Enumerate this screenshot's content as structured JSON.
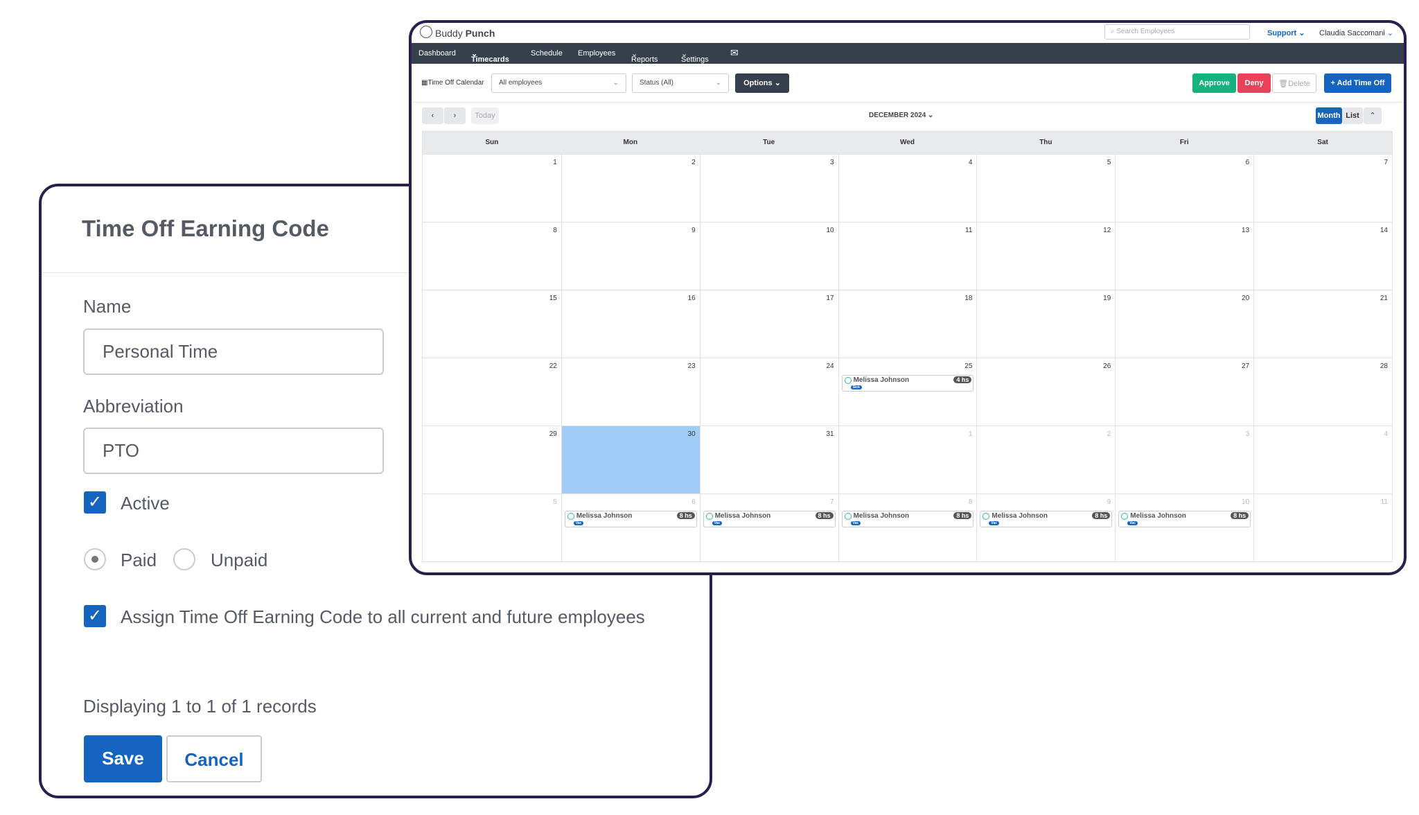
{
  "form": {
    "title": "Time Off Earning Code",
    "name_label": "Name",
    "name_value": "Personal Time",
    "abbr_label": "Abbreviation",
    "abbr_value": "PTO",
    "active_label": "Active",
    "active": true,
    "paid_label": "Paid",
    "unpaid_label": "Unpaid",
    "pay_type": "Paid",
    "assign_label": "Assign Time Off Earning Code to all current and future employees",
    "assign": true,
    "records": "Displaying 1 to 1 of 1 records",
    "save": "Save",
    "cancel": "Cancel"
  },
  "app": {
    "brand_light": "Buddy",
    "brand_bold": "Punch",
    "search_placeholder": "Search Employees",
    "support": "Support",
    "user": "Claudia Saccomani",
    "nav": [
      "Dashboard",
      "Timecards",
      "Schedule",
      "Employees",
      "Reports",
      "Settings"
    ],
    "toolbar": {
      "page": "Time Off Calendar",
      "employees": "All employees",
      "status": "Status (All)",
      "options": "Options",
      "approve": "Approve",
      "deny": "Deny",
      "delete": "Delete",
      "add": "+ Add Time Off"
    },
    "calnav": {
      "today": "Today",
      "month_title": "DECEMBER 2024",
      "month": "Month",
      "list": "List"
    },
    "colors": {
      "nav": "#36404d",
      "approve": "#14b37d",
      "deny": "#e8435a",
      "primary": "#1565c0",
      "selected_day": "#a0cdf5"
    }
  },
  "calendar": {
    "days": [
      "Sun",
      "Mon",
      "Tue",
      "Wed",
      "Thu",
      "Fri",
      "Sat"
    ],
    "weeks": [
      [
        {
          "d": "1"
        },
        {
          "d": "2"
        },
        {
          "d": "3"
        },
        {
          "d": "4"
        },
        {
          "d": "5"
        },
        {
          "d": "6"
        },
        {
          "d": "7"
        }
      ],
      [
        {
          "d": "8"
        },
        {
          "d": "9"
        },
        {
          "d": "10"
        },
        {
          "d": "11"
        },
        {
          "d": "12"
        },
        {
          "d": "13"
        },
        {
          "d": "14"
        }
      ],
      [
        {
          "d": "15"
        },
        {
          "d": "16"
        },
        {
          "d": "17"
        },
        {
          "d": "18"
        },
        {
          "d": "19"
        },
        {
          "d": "20"
        },
        {
          "d": "21"
        }
      ],
      [
        {
          "d": "22"
        },
        {
          "d": "23"
        },
        {
          "d": "24"
        },
        {
          "d": "25",
          "event": {
            "name": "Melissa Johnson",
            "hours": "4 hs",
            "type": "Sick"
          }
        },
        {
          "d": "26"
        },
        {
          "d": "27"
        },
        {
          "d": "28"
        }
      ],
      [
        {
          "d": "29"
        },
        {
          "d": "30",
          "selected": true
        },
        {
          "d": "31"
        },
        {
          "d": "1",
          "muted": true
        },
        {
          "d": "2",
          "muted": true
        },
        {
          "d": "3",
          "muted": true
        },
        {
          "d": "4",
          "muted": true
        }
      ],
      [
        {
          "d": "5",
          "muted": true
        },
        {
          "d": "6",
          "muted": true,
          "event": {
            "name": "Melissa Johnson",
            "hours": "8 hs",
            "type": "Vac"
          }
        },
        {
          "d": "7",
          "muted": true,
          "event": {
            "name": "Melissa Johnson",
            "hours": "8 hs",
            "type": "Vac"
          }
        },
        {
          "d": "8",
          "muted": true,
          "event": {
            "name": "Melissa Johnson",
            "hours": "8 hs",
            "type": "Vac"
          }
        },
        {
          "d": "9",
          "muted": true,
          "event": {
            "name": "Melissa Johnson",
            "hours": "8 hs",
            "type": "Vac"
          }
        },
        {
          "d": "10",
          "muted": true,
          "event": {
            "name": "Melissa Johnson",
            "hours": "8 hs",
            "type": "Vac"
          }
        },
        {
          "d": "11",
          "muted": true
        }
      ]
    ]
  }
}
